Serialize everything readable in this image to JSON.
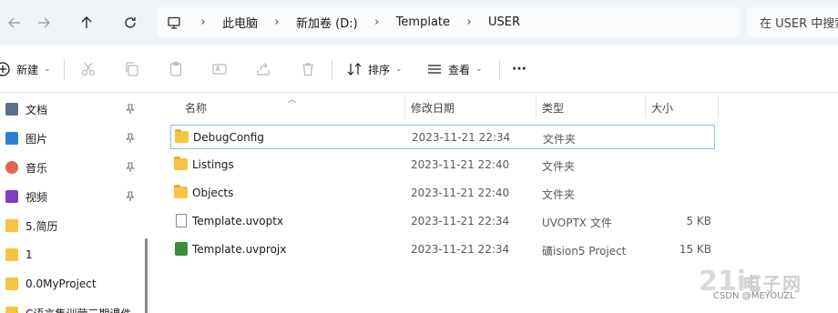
{
  "address_bar": {
    "breadcrumbs": [
      "此电脑",
      "新加卷 (D:)",
      "Template",
      "USER"
    ],
    "search_placeholder": "在 USER 中搜索"
  },
  "command_bar": {
    "new_label": "新建",
    "sort_label": "排序",
    "view_label": "查看",
    "more_label": "···"
  },
  "sidebar": {
    "items": [
      {
        "label": "文档",
        "icon": "document-icon",
        "pinned": true
      },
      {
        "label": "图片",
        "icon": "picture-icon",
        "pinned": true
      },
      {
        "label": "音乐",
        "icon": "music-icon",
        "pinned": true
      },
      {
        "label": "视频",
        "icon": "video-icon",
        "pinned": true
      },
      {
        "label": "5.简历",
        "icon": "folder-icon",
        "pinned": false
      },
      {
        "label": "1",
        "icon": "folder-icon",
        "pinned": false
      },
      {
        "label": "0.0MyProject",
        "icon": "folder-icon",
        "pinned": false
      },
      {
        "label": "C语言集训营三期课件",
        "icon": "folder-icon",
        "pinned": false
      }
    ]
  },
  "file_list": {
    "columns": {
      "name": "名称",
      "date": "修改日期",
      "type": "类型",
      "size": "大小"
    },
    "rows": [
      {
        "name": "DebugConfig",
        "date": "2023-11-21 22:34",
        "type": "文件夹",
        "size": "",
        "icon": "folder-icon",
        "selected": true
      },
      {
        "name": "Listings",
        "date": "2023-11-21 22:40",
        "type": "文件夹",
        "size": "",
        "icon": "folder-icon",
        "selected": false
      },
      {
        "name": "Objects",
        "date": "2023-11-21 22:40",
        "type": "文件夹",
        "size": "",
        "icon": "folder-icon",
        "selected": false
      },
      {
        "name": "Template.uvoptx",
        "date": "2023-11-21 22:34",
        "type": "UVOPTX 文件",
        "size": "5 KB",
        "icon": "file-icon",
        "selected": false
      },
      {
        "name": "Template.uvprojx",
        "date": "2023-11-21 22:34",
        "type": "礦ision5 Project",
        "size": "15 KB",
        "icon": "uvision-project-icon",
        "selected": false
      }
    ]
  },
  "watermark": {
    "brand_glyph": "21ic",
    "brand_text": "电子网",
    "credit": "CSDN @MEYOUZL"
  },
  "colors": {
    "address_bar_bg": "#eff4f9",
    "folder": "#f6c445",
    "selection_border": "#8cc0ef"
  }
}
